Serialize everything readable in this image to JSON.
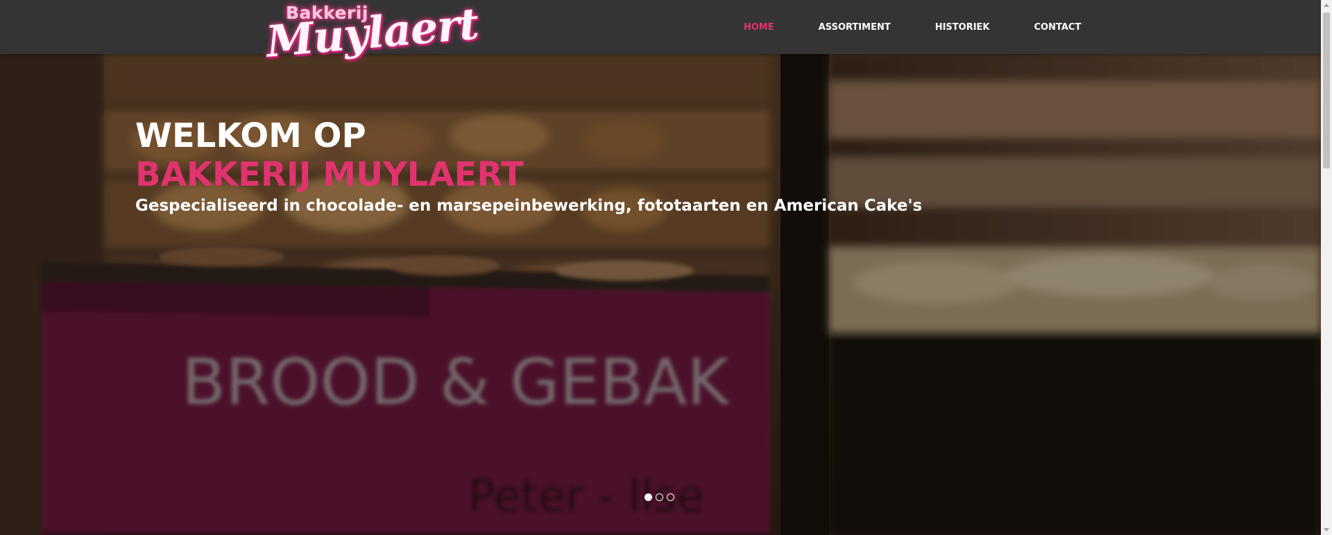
{
  "logo": {
    "small": "Bakkerij",
    "big": "Muylaert"
  },
  "nav": {
    "items": [
      {
        "label": "HOME",
        "active": true
      },
      {
        "label": "ASSORTIMENT",
        "active": false
      },
      {
        "label": "HISTORIEK",
        "active": false
      },
      {
        "label": "CONTACT",
        "active": false
      }
    ]
  },
  "hero": {
    "line1": "WELKOM OP",
    "line2": "BAKKERIJ MUYLAERT",
    "line3": "Gespecialiseerd in chocolade- en marsepeinbewerking, fototaarten en American Cake's",
    "sign_text_1": "BROOD & GEBAK",
    "sign_text_2": "Peter - Ilse",
    "slide_count": 3,
    "active_slide": 1
  },
  "colors": {
    "header_bg": "#343434",
    "accent": "#e0336f",
    "text": "#ffffff"
  }
}
